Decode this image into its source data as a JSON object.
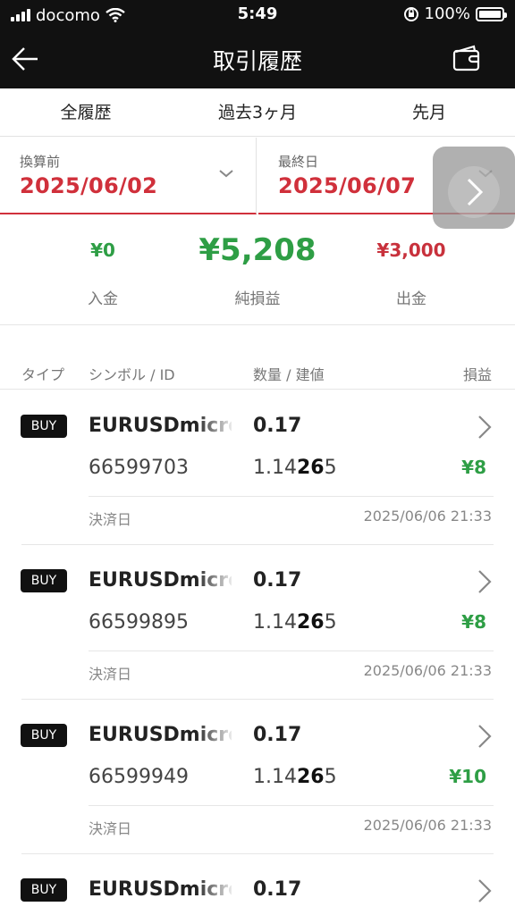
{
  "status_bar": {
    "carrier": "docomo",
    "time": "5:49",
    "battery": "100%",
    "battery_level": 1.0
  },
  "header": {
    "title": "取引履歴",
    "back_icon": "back-arrow-icon",
    "wallet_icon": "wallet-icon"
  },
  "tabs": [
    {
      "label": "全履歴"
    },
    {
      "label": "過去3ヶ月"
    },
    {
      "label": "先月"
    }
  ],
  "filters": {
    "from": {
      "label": "換算前",
      "value": "2025/06/02"
    },
    "to": {
      "label": "最終日",
      "value": "2025/06/07"
    }
  },
  "summary": {
    "deposit": {
      "value": "¥0",
      "label": "入金"
    },
    "net": {
      "value": "¥5,208",
      "label": "純損益"
    },
    "withdrawal": {
      "value": "¥3,000",
      "label": "出金"
    }
  },
  "columns": {
    "type": "タイプ",
    "symbol_id": "シンボル / ID",
    "qty_price": "数量 / 建値",
    "pl": "損益"
  },
  "trades": [
    {
      "type": "BUY",
      "symbol": "EURUSDmicro",
      "qty": "0.17",
      "id": "66599703",
      "price_pre": "1.14",
      "price_big": "26",
      "price_post": "5",
      "pl": "¥8",
      "settle_label": "決済日",
      "settle_date": "2025/06/06 21:33"
    },
    {
      "type": "BUY",
      "symbol": "EURUSDmicro",
      "qty": "0.17",
      "id": "66599895",
      "price_pre": "1.14",
      "price_big": "26",
      "price_post": "5",
      "pl": "¥8",
      "settle_label": "決済日",
      "settle_date": "2025/06/06 21:33"
    },
    {
      "type": "BUY",
      "symbol": "EURUSDmicro",
      "qty": "0.17",
      "id": "66599949",
      "price_pre": "1.14",
      "price_big": "26",
      "price_post": "5",
      "pl": "¥10",
      "settle_label": "決済日",
      "settle_date": "2025/06/06 21:33"
    },
    {
      "type": "BUY",
      "symbol": "EURUSDmicro",
      "qty": "0.17"
    }
  ],
  "colors": {
    "header_bg": "#111111",
    "accent_red": "#d0303b",
    "profit_green": "#2e9e45"
  }
}
